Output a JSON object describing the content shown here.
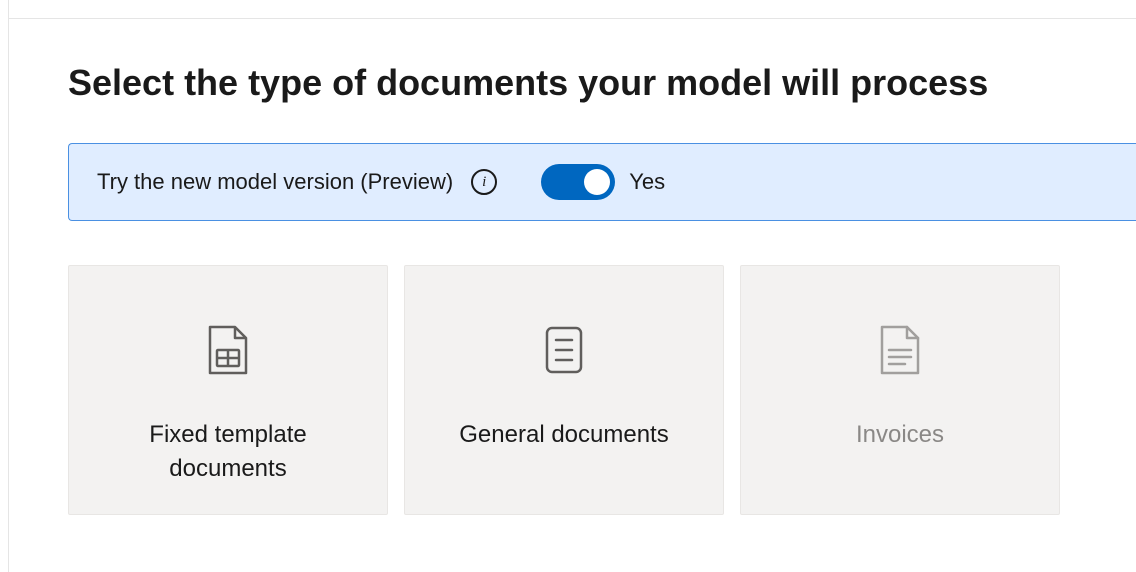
{
  "heading": "Select the type of documents your model will process",
  "preview": {
    "label": "Try the new model version (Preview)",
    "toggle_state": "Yes",
    "toggle_on": true
  },
  "cards": [
    {
      "label": "Fixed template documents",
      "disabled": false
    },
    {
      "label": "General documents",
      "disabled": false
    },
    {
      "label": "Invoices",
      "disabled": true
    }
  ]
}
